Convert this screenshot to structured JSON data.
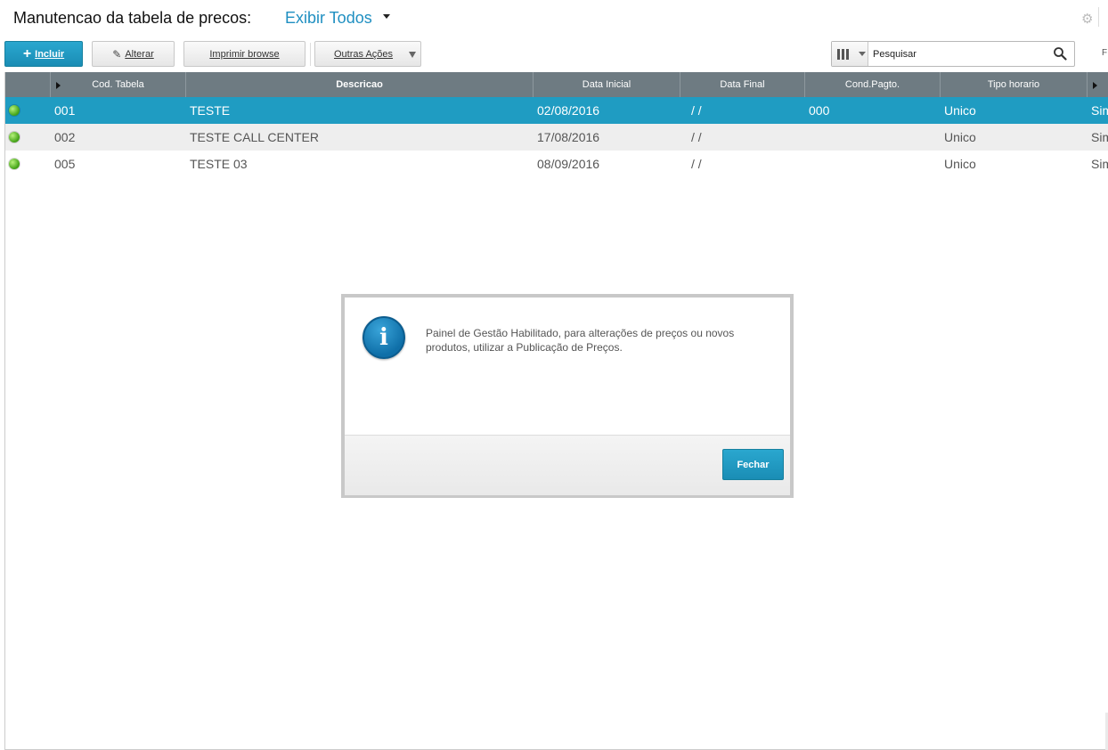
{
  "header": {
    "title": "Manutencao da tabela de precos:",
    "filter_label": "Exibir Todos"
  },
  "toolbar": {
    "incluir": "Incluir",
    "alterar": "Alterar",
    "imprimir": "Imprimir browse",
    "outras": "Outras Ações",
    "search_value": "Pesquisar",
    "right_label": "F"
  },
  "grid": {
    "columns": [
      "Cod. Tabela",
      "Descricao",
      "Data Inicial",
      "Data Final",
      "Cond.Pagto.",
      "Tipo horario"
    ],
    "rows": [
      {
        "status": "active",
        "cod": "001",
        "desc": "TESTE",
        "data_inicial": "02/08/2016",
        "data_final": "/  /",
        "cond": "000",
        "tipo": "Unico",
        "extra": "Sim"
      },
      {
        "status": "active",
        "cod": "002",
        "desc": "TESTE CALL CENTER",
        "data_inicial": "17/08/2016",
        "data_final": "/  /",
        "cond": "",
        "tipo": "Unico",
        "extra": "Sim"
      },
      {
        "status": "active",
        "cod": "005",
        "desc": "TESTE 03",
        "data_inicial": "08/09/2016",
        "data_final": "/  /",
        "cond": "",
        "tipo": "Unico",
        "extra": "Sim"
      }
    ]
  },
  "dialog": {
    "message": "Painel de Gestão Habilitado, para alterações de preços ou novos produtos, utilizar a Publicação de Preços.",
    "close_label": "Fechar"
  },
  "colors": {
    "accent": "#1f9cc2",
    "header_bg": "#6e7b82",
    "status_green": "#47a51a"
  }
}
